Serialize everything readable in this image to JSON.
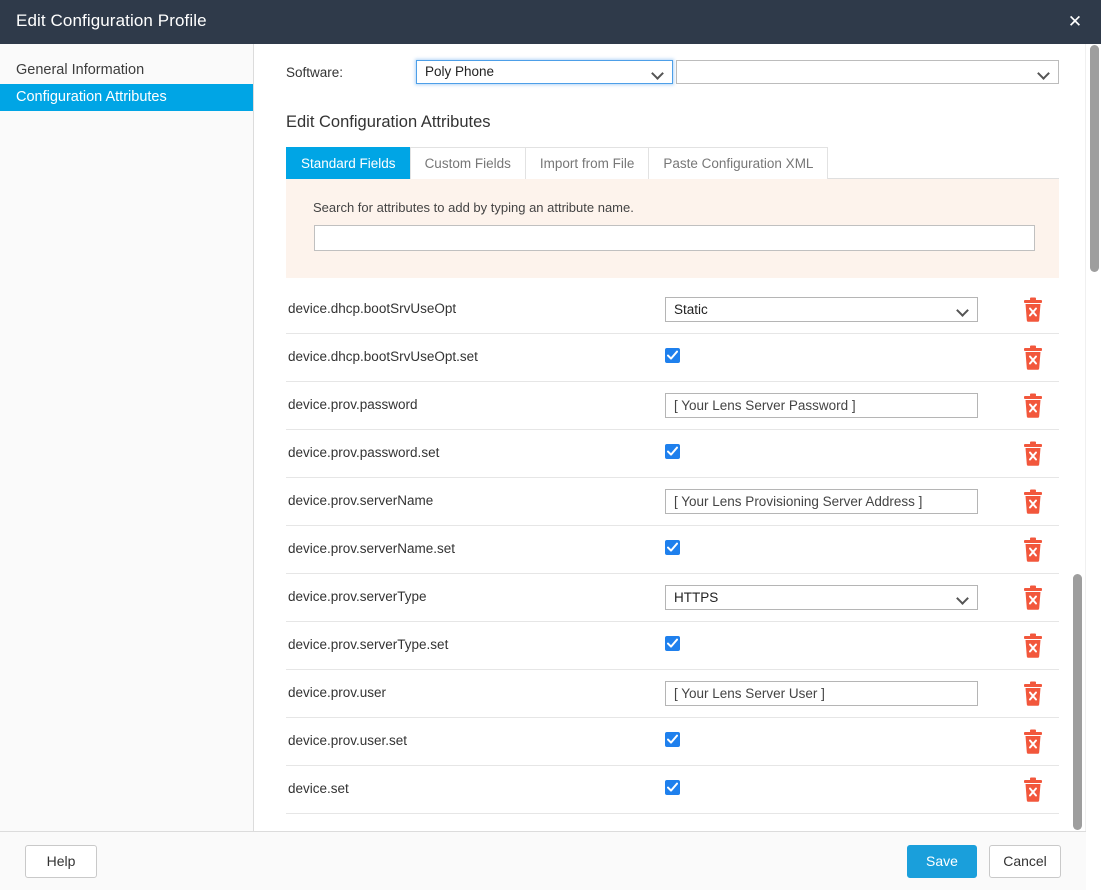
{
  "window": {
    "title": "Edit Configuration Profile",
    "close_icon": "close-icon",
    "close_glyph": "✕"
  },
  "sidebar": {
    "items": [
      {
        "label": "General Information",
        "active": false
      },
      {
        "label": "Configuration Attributes",
        "active": true
      }
    ]
  },
  "software": {
    "label": "Software:",
    "selected": "Poly Phone",
    "secondary_selected": ""
  },
  "main": {
    "section_title": "Edit Configuration Attributes",
    "tabs": [
      {
        "label": "Standard Fields",
        "active": true
      },
      {
        "label": "Custom Fields",
        "active": false
      },
      {
        "label": "Import from File",
        "active": false
      },
      {
        "label": "Paste Configuration XML",
        "active": false
      }
    ],
    "search": {
      "hint": "Search for attributes to add by typing an attribute name.",
      "value": "",
      "placeholder": ""
    },
    "delete_icon": "trash-delete-icon",
    "attributes": [
      {
        "name": "device.dhcp.bootSrvUseOpt",
        "type": "select",
        "value": "Static"
      },
      {
        "name": "device.dhcp.bootSrvUseOpt.set",
        "type": "checkbox",
        "value": "checked"
      },
      {
        "name": "device.prov.password",
        "type": "text",
        "value": "[ Your Lens Server Password ]"
      },
      {
        "name": "device.prov.password.set",
        "type": "checkbox",
        "value": "checked"
      },
      {
        "name": "device.prov.serverName",
        "type": "text",
        "value": "[ Your Lens Provisioning Server Address ]"
      },
      {
        "name": "device.prov.serverName.set",
        "type": "checkbox",
        "value": "checked"
      },
      {
        "name": "device.prov.serverType",
        "type": "select",
        "value": "HTTPS"
      },
      {
        "name": "device.prov.serverType.set",
        "type": "checkbox",
        "value": "checked"
      },
      {
        "name": "device.prov.user",
        "type": "text",
        "value": "[ Your Lens Server User ]"
      },
      {
        "name": "device.prov.user.set",
        "type": "checkbox",
        "value": "checked"
      },
      {
        "name": "device.set",
        "type": "checkbox",
        "value": "checked"
      }
    ]
  },
  "footer": {
    "help_label": "Help",
    "save_label": "Save",
    "cancel_label": "Cancel"
  },
  "colors": {
    "titlebar": "#2f3a4a",
    "accent": "#00a5e5",
    "save": "#1a9fdb",
    "checkbox": "#1f80ed",
    "delete": "#f2573c",
    "search_panel": "#fdf3ec"
  }
}
